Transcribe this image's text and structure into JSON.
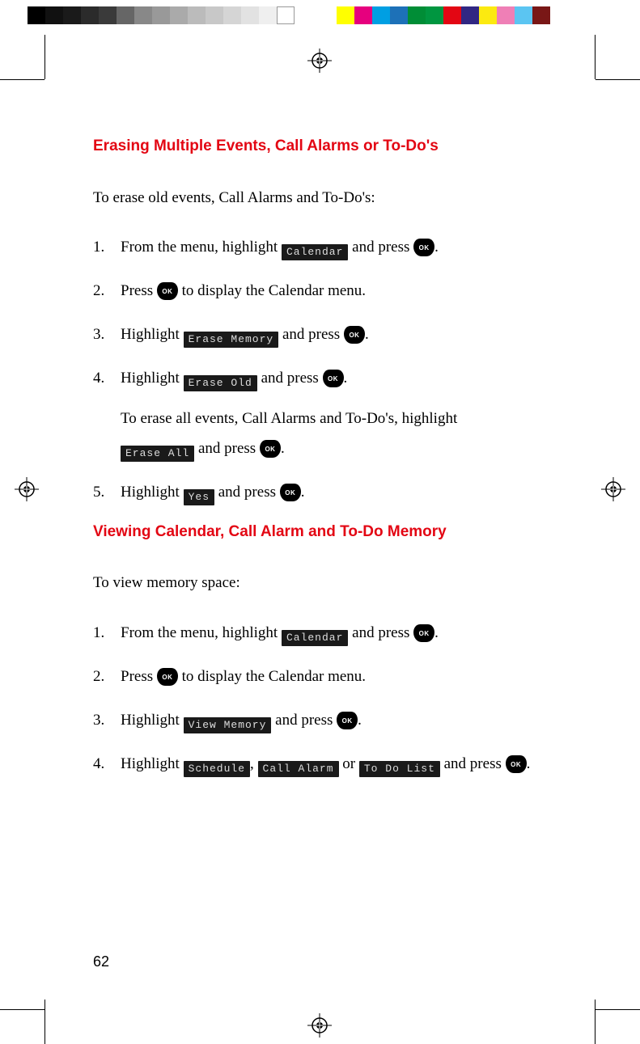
{
  "page_number": "62",
  "section1": {
    "heading": "Erasing Multiple Events, Call Alarms or To-Do's",
    "intro": "To erase old events, Call Alarms and To-Do's:",
    "steps": {
      "s1a": "From the menu, highlight ",
      "s1b": " and press ",
      "s1_menu": "Calendar",
      "s2a": "Press ",
      "s2b": " to display the Calendar menu.",
      "s3a": "Highlight ",
      "s3b": " and press ",
      "s3_menu": "Erase Memory",
      "s4a": "Highlight ",
      "s4b": " and press ",
      "s4_menu": "Erase Old",
      "s4_sub_a": "To erase all events, Call Alarms and To-Do's, highlight ",
      "s4_sub_b": " and press ",
      "s4_sub_menu": "Erase All",
      "s5a": "Highlight ",
      "s5b": " and press ",
      "s5_menu": "Yes"
    }
  },
  "section2": {
    "heading": "Viewing Calendar, Call Alarm and To-Do Memory",
    "intro": "To view memory space:",
    "steps": {
      "s1a": "From the menu, highlight ",
      "s1b": " and press ",
      "s1_menu": "Calendar",
      "s2a": "Press ",
      "s2b": " to display the Calendar menu.",
      "s3a": "Highlight ",
      "s3b": " and press ",
      "s3_menu": "View Memory",
      "s4a": "Highlight ",
      "s4b": ", ",
      "s4c": " or ",
      "s4d": " and press ",
      "s4_menu1": "Schedule",
      "s4_menu2": "Call Alarm",
      "s4_menu3": "To Do List"
    }
  }
}
